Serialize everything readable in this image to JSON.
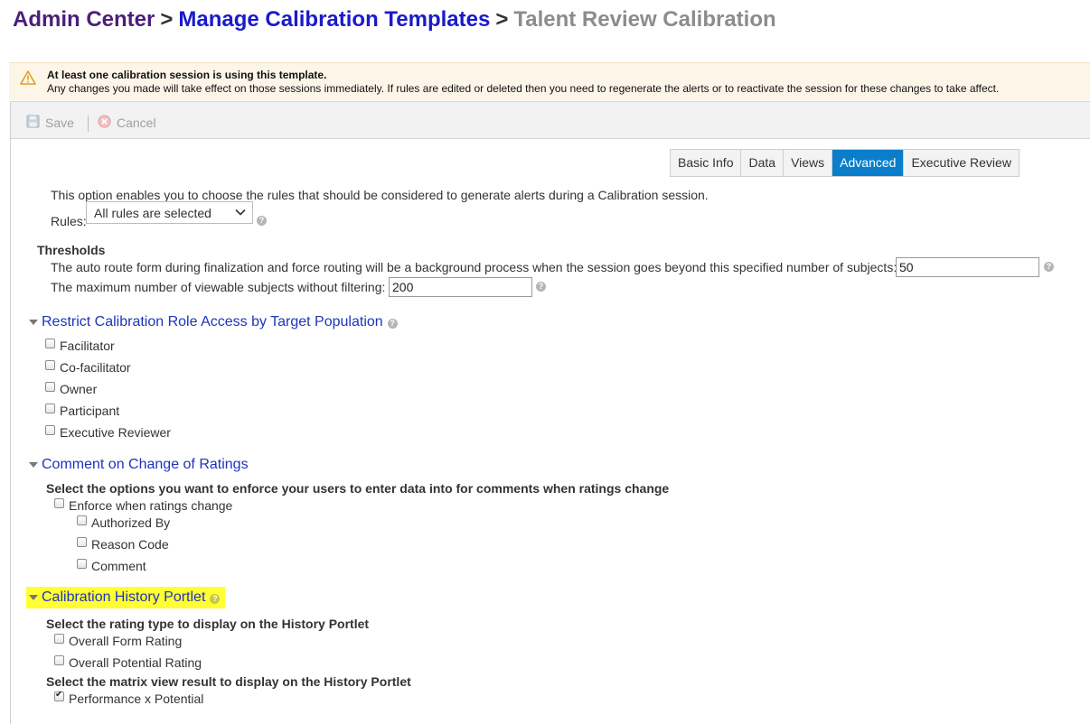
{
  "breadcrumb": {
    "admin_center": "Admin Center",
    "separator": ">",
    "manage_templates": "Manage Calibration Templates",
    "current": "Talent Review Calibration"
  },
  "warning": {
    "title": "At least one calibration session is using this template.",
    "message": "Any changes you made will take effect on those sessions immediately. If rules are edited or deleted then you need to regenerate the alerts or to reactivate the session for these changes to take affect."
  },
  "toolbar": {
    "save_label": "Save",
    "cancel_label": "Cancel"
  },
  "tabs": [
    {
      "label": "Basic Info",
      "active": false
    },
    {
      "label": "Data",
      "active": false
    },
    {
      "label": "Views",
      "active": false
    },
    {
      "label": "Advanced",
      "active": true
    },
    {
      "label": "Executive Review",
      "active": false
    }
  ],
  "rules": {
    "description": "This option enables you to choose the rules that should be considered to generate alerts during a Calibration session.",
    "label": "Rules:",
    "selected": "All rules are selected"
  },
  "thresholds": {
    "title": "Thresholds",
    "auto_route_label": "The auto route form during finalization and force routing will be a background process when the session goes beyond this specified number of subjects:",
    "auto_route_value": "50",
    "max_viewable_label": "The maximum number of viewable subjects without filtering:",
    "max_viewable_value": "200"
  },
  "restrict_access": {
    "title": "Restrict Calibration Role Access by Target Population",
    "roles": [
      {
        "label": "Facilitator",
        "checked": false
      },
      {
        "label": "Co-facilitator",
        "checked": false
      },
      {
        "label": "Owner",
        "checked": false
      },
      {
        "label": "Participant",
        "checked": false
      },
      {
        "label": "Executive Reviewer",
        "checked": false
      }
    ]
  },
  "comment_change": {
    "title": "Comment on Change of Ratings",
    "subtitle": "Select the options you want to enforce your users to enter data into for comments when ratings change",
    "enforce_label": "Enforce when ratings change",
    "options": [
      {
        "label": "Authorized By",
        "checked": false
      },
      {
        "label": "Reason Code",
        "checked": false
      },
      {
        "label": "Comment",
        "checked": false
      }
    ]
  },
  "history_portlet": {
    "title": "Calibration History Portlet",
    "rating_type_heading": "Select the rating type to display on the History Portlet",
    "rating_types": [
      {
        "label": "Overall Form Rating",
        "checked": false
      },
      {
        "label": "Overall Potential Rating",
        "checked": false
      }
    ],
    "matrix_heading": "Select the matrix view result to display on the History Portlet",
    "matrix_views": [
      {
        "label": "Performance x Potential",
        "checked": true
      }
    ]
  },
  "colors": {
    "accent_tab": "#0a7ecb",
    "link_blue": "#1f34bb",
    "highlight": "#ffff33",
    "warning_bg": "#fdf5e8"
  }
}
